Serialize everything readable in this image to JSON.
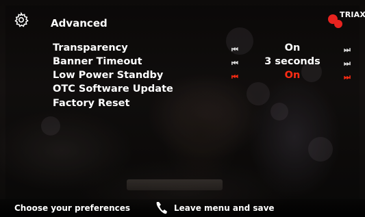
{
  "header": {
    "title": "Advanced",
    "icon": "gear-icon",
    "brand": "TRIAX",
    "brand_color": "#e8231f"
  },
  "menu": {
    "items": [
      {
        "label": "Transparency",
        "value": "On",
        "highlighted": false
      },
      {
        "label": "Banner Timeout",
        "value": "3 seconds",
        "highlighted": false
      },
      {
        "label": "Low Power Standby",
        "value": "On",
        "highlighted": true
      },
      {
        "label": "OTC Software Update"
      },
      {
        "label": "Factory Reset"
      }
    ],
    "highlight_color": "#ff2c14"
  },
  "footer": {
    "hint_left": "Choose your preferences",
    "hint_right": "Leave menu and save",
    "hint_right_icon": "phone-icon"
  }
}
